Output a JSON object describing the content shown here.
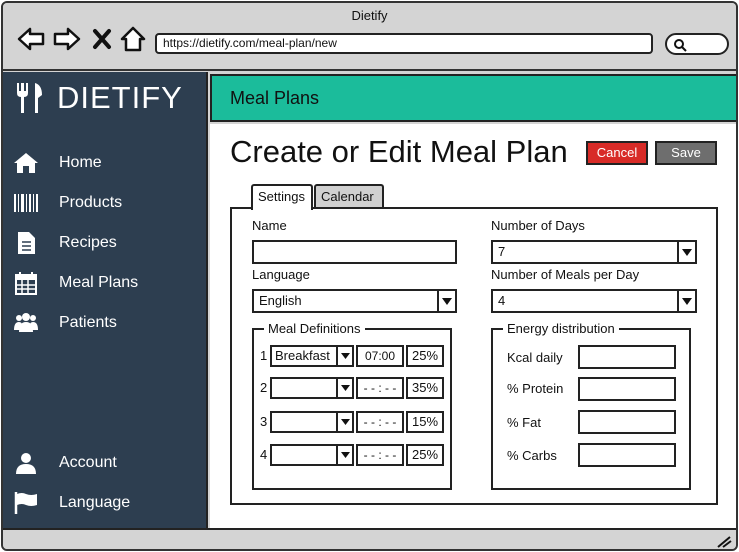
{
  "window": {
    "title": "Dietify"
  },
  "browser": {
    "url": "https://dietify.com/meal-plan/new"
  },
  "sidebar": {
    "brand": "DIETIFY",
    "items": [
      {
        "label": "Home",
        "icon": "home-icon"
      },
      {
        "label": "Products",
        "icon": "barcode-icon"
      },
      {
        "label": "Recipes",
        "icon": "document-icon"
      },
      {
        "label": "Meal Plans",
        "icon": "calendar-icon"
      },
      {
        "label": "Patients",
        "icon": "users-icon"
      }
    ],
    "bottom_items": [
      {
        "label": "Account",
        "icon": "user-icon"
      },
      {
        "label": "Language",
        "icon": "flag-icon"
      }
    ]
  },
  "header": {
    "title": "Meal Plans"
  },
  "page": {
    "title": "Create or Edit Meal Plan",
    "cancel_label": "Cancel",
    "save_label": "Save"
  },
  "tabs": [
    {
      "label": "Settings",
      "active": true
    },
    {
      "label": "Calendar",
      "active": false
    }
  ],
  "form": {
    "name_label": "Name",
    "name_value": "",
    "days_label": "Number of Days",
    "days_value": "7",
    "language_label": "Language",
    "language_value": "English",
    "meals_label": "Number of Meals per Day",
    "meals_value": "4"
  },
  "meal_definitions": {
    "legend": "Meal Definitions",
    "rows": [
      {
        "num": "1",
        "meal": "Breakfast",
        "time": "07:00",
        "percent": "25%"
      },
      {
        "num": "2",
        "meal": "",
        "time": "- - : - -",
        "percent": "35%"
      },
      {
        "num": "3",
        "meal": "",
        "time": "- - : - -",
        "percent": "15%"
      },
      {
        "num": "4",
        "meal": "",
        "time": "- - : - -",
        "percent": "25%"
      }
    ]
  },
  "energy": {
    "legend": "Energy distribution",
    "fields": [
      {
        "label": "Kcal daily",
        "value": ""
      },
      {
        "label": "% Protein",
        "value": ""
      },
      {
        "label": "% Fat",
        "value": ""
      },
      {
        "label": "% Carbs",
        "value": ""
      }
    ]
  },
  "colors": {
    "sidebar": "#2d3e50",
    "header": "#1bbc9b",
    "cancel": "#d82b27",
    "save": "#6e6e6e"
  }
}
